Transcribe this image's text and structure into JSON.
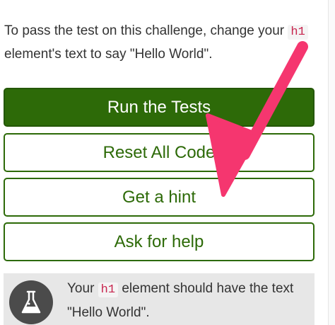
{
  "instructions": {
    "prefix": "To pass the test on this challenge, change your ",
    "code": "h1",
    "suffix": " element's text to say \"Hello World\"."
  },
  "buttons": {
    "run": "Run the Tests",
    "reset": "Reset All Code",
    "hint": "Get a hint",
    "help": "Ask for help"
  },
  "test": {
    "prefix": "Your ",
    "code": "h1",
    "suffix": " element should have the text \"Hello World\".",
    "icon": "beaker-icon"
  },
  "colors": {
    "primary": "#2d6a08",
    "annotation_arrow": "#f5366f",
    "code_text": "#c7254e"
  }
}
